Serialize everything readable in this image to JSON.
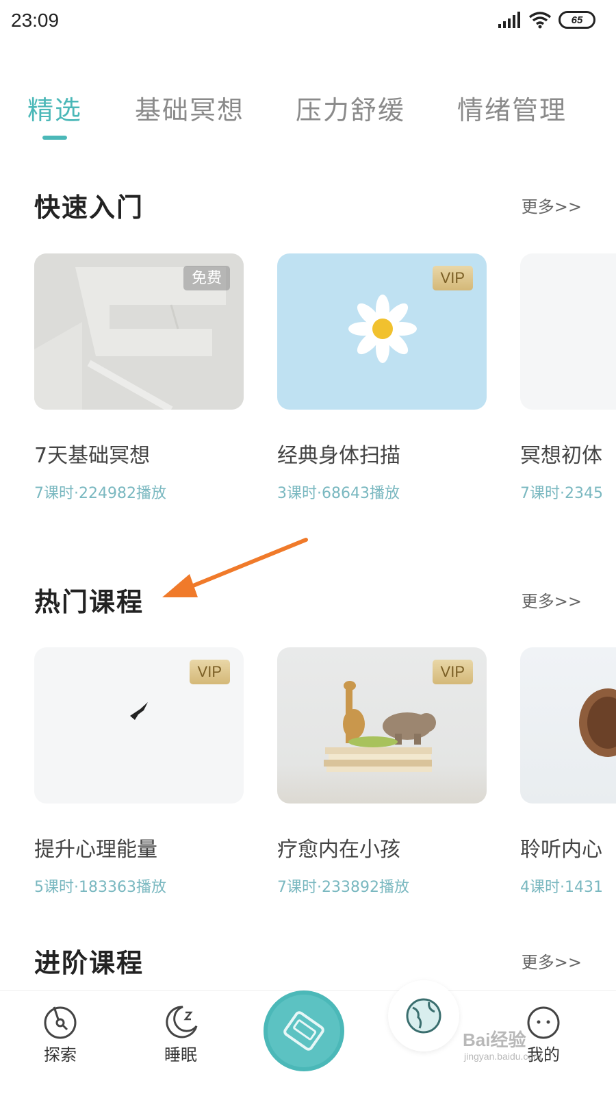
{
  "status_bar": {
    "time": "23:09",
    "battery": "65"
  },
  "tabs": [
    {
      "label": "精选",
      "active": true
    },
    {
      "label": "基础冥想",
      "active": false
    },
    {
      "label": "压力舒缓",
      "active": false
    },
    {
      "label": "情绪管理",
      "active": false
    }
  ],
  "sections": [
    {
      "title": "快速入门",
      "more": "更多>>",
      "cards": [
        {
          "title": "7天基础冥想",
          "meta": "7课时·224982播放",
          "badge": "免费"
        },
        {
          "title": "经典身体扫描",
          "meta": "3课时·68643播放",
          "badge": "VIP"
        },
        {
          "title": "冥想初体",
          "meta": "7课时·2345"
        }
      ]
    },
    {
      "title": "热门课程",
      "more": "更多>>",
      "cards": [
        {
          "title": "提升心理能量",
          "meta": "5课时·183363播放",
          "badge": "VIP"
        },
        {
          "title": "疗愈内在小孩",
          "meta": "7课时·233892播放",
          "badge": "VIP"
        },
        {
          "title": "聆听内心",
          "meta": "4课时·1431"
        }
      ]
    },
    {
      "title": "进阶课程",
      "more": "更多>>"
    }
  ],
  "bottom_nav": [
    {
      "label": "探索",
      "icon": "compass-icon"
    },
    {
      "label": "睡眠",
      "icon": "moon-icon"
    },
    {
      "label": "",
      "icon": "player-cassette-icon"
    },
    {
      "label": "",
      "icon": "globe-icon"
    },
    {
      "label": "我的",
      "icon": "face-icon"
    }
  ],
  "watermark": {
    "text": "Bai经验",
    "sub": "jingyan.baidu.com"
  },
  "colors": {
    "accent": "#4bb8b8",
    "meta": "#7ab8c0",
    "annotation_arrow": "#f07a2a",
    "vip_gold": "#d4b878"
  }
}
